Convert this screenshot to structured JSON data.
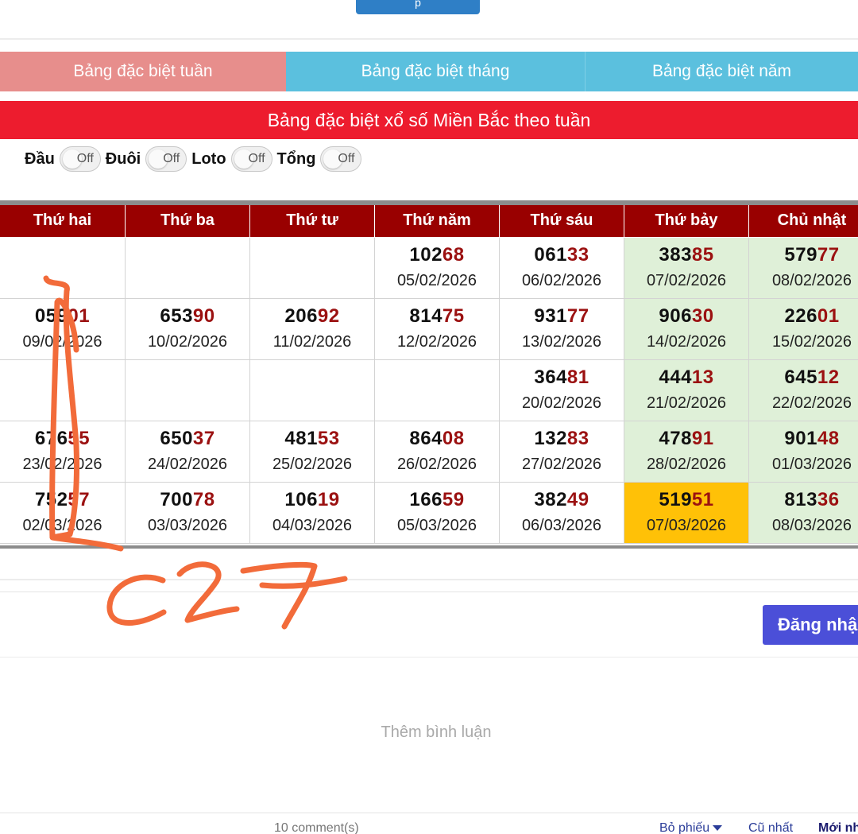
{
  "top_button": {
    "label": "p"
  },
  "tabs": [
    {
      "label": "Bảng đặc biệt tuần",
      "active": true,
      "color": "#e78e8c"
    },
    {
      "label": "Bảng đặc biệt tháng",
      "active": false,
      "color": "#5bc0de"
    },
    {
      "label": "Bảng đặc biệt năm",
      "active": false,
      "color": "#5bc0de"
    }
  ],
  "banner": {
    "title": "Bảng đặc biệt xổ số Miền Bắc theo tuần",
    "color": "#ed1c2e"
  },
  "toggles": [
    {
      "label": "Đầu",
      "state": "Off"
    },
    {
      "label": "Đuôi",
      "state": "Off"
    },
    {
      "label": "Loto",
      "state": "Off"
    },
    {
      "label": "Tổng",
      "state": "Off"
    }
  ],
  "table": {
    "header_color": "#990000",
    "weekend_color": "#dff0d8",
    "highlight_color": "#ffc107",
    "headers": [
      "Thứ hai",
      "Thứ ba",
      "Thứ tư",
      "Thứ năm",
      "Thứ sáu",
      "Thứ bảy",
      "Chủ nhật"
    ],
    "rows": [
      [
        {
          "num": "",
          "date": ""
        },
        {
          "num": "",
          "date": ""
        },
        {
          "num": "",
          "date": ""
        },
        {
          "num": "10268",
          "date": "05/02/2026"
        },
        {
          "num": "06133",
          "date": "06/02/2026"
        },
        {
          "num": "38385",
          "date": "07/02/2026"
        },
        {
          "num": "57977",
          "date": "08/02/2026"
        }
      ],
      [
        {
          "num": "05901",
          "date": "09/02/2026"
        },
        {
          "num": "65390",
          "date": "10/02/2026"
        },
        {
          "num": "20692",
          "date": "11/02/2026"
        },
        {
          "num": "81475",
          "date": "12/02/2026"
        },
        {
          "num": "93177",
          "date": "13/02/2026"
        },
        {
          "num": "90630",
          "date": "14/02/2026"
        },
        {
          "num": "22601",
          "date": "15/02/2026"
        }
      ],
      [
        {
          "num": "",
          "date": ""
        },
        {
          "num": "",
          "date": ""
        },
        {
          "num": "",
          "date": ""
        },
        {
          "num": "",
          "date": ""
        },
        {
          "num": "36481",
          "date": "20/02/2026"
        },
        {
          "num": "44413",
          "date": "21/02/2026"
        },
        {
          "num": "64512",
          "date": "22/02/2026"
        }
      ],
      [
        {
          "num": "67655",
          "date": "23/02/2026"
        },
        {
          "num": "65037",
          "date": "24/02/2026"
        },
        {
          "num": "48153",
          "date": "25/02/2026"
        },
        {
          "num": "86408",
          "date": "26/02/2026"
        },
        {
          "num": "13283",
          "date": "27/02/2026"
        },
        {
          "num": "47891",
          "date": "28/02/2026"
        },
        {
          "num": "90148",
          "date": "01/03/2026"
        }
      ],
      [
        {
          "num": "75257",
          "date": "02/03/2026"
        },
        {
          "num": "70078",
          "date": "03/03/2026"
        },
        {
          "num": "10619",
          "date": "04/03/2026"
        },
        {
          "num": "16659",
          "date": "05/03/2026"
        },
        {
          "num": "38249",
          "date": "06/03/2026"
        },
        {
          "num": "51951",
          "date": "07/03/2026",
          "highlight": true
        },
        {
          "num": "81336",
          "date": "08/03/2026"
        }
      ]
    ]
  },
  "login_button": {
    "label": "Đăng nhập",
    "color": "#4b4fd8"
  },
  "comments": {
    "placeholder": "Thêm bình luận",
    "count": "10 comment(s)",
    "sort_vote": "Bỏ phiếu",
    "sort_old": "Cũ nhất",
    "sort_new": "Mới nhất"
  },
  "annotation": {
    "text": "c27",
    "color": "#f26b3a"
  }
}
